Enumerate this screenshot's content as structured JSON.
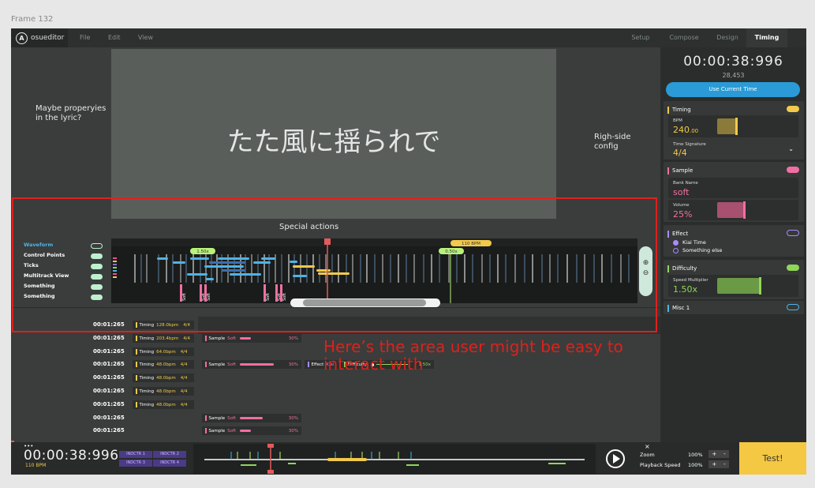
{
  "frame_label": "Frame 132",
  "app": {
    "name": "osueditor",
    "menu": [
      "File",
      "Edit",
      "View"
    ],
    "modes": [
      "Setup",
      "Compose",
      "Design",
      "Timing"
    ],
    "active_mode": "Timing"
  },
  "preview": {
    "lyric": "たた風に揺られで",
    "left_note": "Maybe properyies in the lyric?",
    "right_note": "Righ-side config"
  },
  "special_actions": "Special actions",
  "side_toggles": [
    {
      "label": "Waveform",
      "on": false,
      "color": "#4fb3e6"
    },
    {
      "label": "Control Points",
      "on": true,
      "color": "#ffffff"
    },
    {
      "label": "Ticks",
      "on": true,
      "color": "#ffffff"
    },
    {
      "label": "Multitrack View",
      "on": true,
      "color": "#ffffff"
    },
    {
      "label": "Something",
      "on": true,
      "color": "#ffffff"
    },
    {
      "label": "Something",
      "on": true,
      "color": "#ffffff"
    }
  ],
  "timeline": {
    "markers": [
      {
        "label": "1.50x",
        "color": "#b9f27a"
      },
      {
        "label": "0.50x",
        "color": "#b9f27a"
      },
      {
        "label": "110 BPM",
        "color": "#f2c94c"
      }
    ],
    "soft_labels": [
      "Soft",
      "Soft",
      "Soft",
      "Soft",
      "Soft",
      "Soft"
    ],
    "zoom_in_icon": "zoom-in-icon",
    "zoom_out_icon": "zoom-out-icon"
  },
  "right_panel": {
    "clock": "00:00:38:996",
    "clock_sub": "28,453",
    "use_current_time": "Use Current Time",
    "timing": {
      "title": "Timing",
      "bpm_label": "BPM",
      "bpm_value": "240",
      "bpm_decimals": ".00",
      "sig_label": "Time Signature",
      "sig_value": "4/4",
      "accent": "#f2c94c"
    },
    "sample": {
      "title": "Sample",
      "bank_label": "Bank Name",
      "bank_value": "soft",
      "volume_label": "Volume",
      "volume_value": "25%",
      "volume_fraction": 0.25,
      "accent": "#f06fa3"
    },
    "effect": {
      "title": "Effect",
      "options": [
        "Kiai Time",
        "Something else"
      ],
      "accent": "#a78bfa"
    },
    "difficulty": {
      "title": "Difficulty",
      "speed_label": "Speed Multiplier",
      "speed_value": "1.50x",
      "accent": "#8fd65a"
    },
    "misc": {
      "title": "Misc 1",
      "accent": "#4fb3e6"
    }
  },
  "events": [
    {
      "time": "00:01:265",
      "chips": [
        {
          "type": "Timing",
          "text": "128.0bpm",
          "sig": "4/4"
        }
      ]
    },
    {
      "time": "00:01:265",
      "chips": [
        {
          "type": "Timing",
          "text": "203.4bpm",
          "sig": "4/4"
        },
        {
          "type": "Sample",
          "bank": "Soft",
          "vol": "30%",
          "fill": 0.3
        }
      ]
    },
    {
      "time": "00:01:265",
      "chips": [
        {
          "type": "Timing",
          "text": "64.0bpm",
          "sig": "4/4"
        }
      ]
    },
    {
      "time": "00:01:265",
      "chips": [
        {
          "type": "Timing",
          "text": "48.0bpm",
          "sig": "4/4"
        },
        {
          "type": "Sample",
          "bank": "Soft",
          "vol": "30%",
          "fill": 0.9
        },
        {
          "type": "Effect",
          "text": "Kiai"
        },
        {
          "type": "Difficulty",
          "text": "1.50x"
        }
      ]
    },
    {
      "time": "00:01:265",
      "chips": [
        {
          "type": "Timing",
          "text": "48.0bpm",
          "sig": "4/4"
        }
      ]
    },
    {
      "time": "00:01:265",
      "chips": [
        {
          "type": "Timing",
          "text": "48.0bpm",
          "sig": "4/4"
        }
      ]
    },
    {
      "time": "00:01:265",
      "chips": [
        {
          "type": "Timing",
          "text": "48.0bpm",
          "sig": "4/4"
        }
      ]
    },
    {
      "time": "00:01:265",
      "chips": [
        {
          "type": "Sample",
          "bank": "Soft",
          "vol": "30%",
          "fill": 0.6
        }
      ]
    },
    {
      "time": "00:01:265",
      "chips": [
        {
          "type": "Sample",
          "bank": "Soft",
          "vol": "30%",
          "fill": 0.3
        }
      ]
    }
  ],
  "annotation": "Here’s the area user might be easy to interact with",
  "bottom": {
    "dots": "•••",
    "clock": "00:00:38:996",
    "bpm": "110 BPM",
    "indicators": [
      "INDCTR 1",
      "INDCTR 2",
      "INDCTR 3",
      "INDCTR 4"
    ],
    "zoom_label": "Zoom",
    "zoom_value": "100%",
    "speed_label": "Playback Speed",
    "speed_value": "100%",
    "close": "×",
    "test": "Test!"
  }
}
